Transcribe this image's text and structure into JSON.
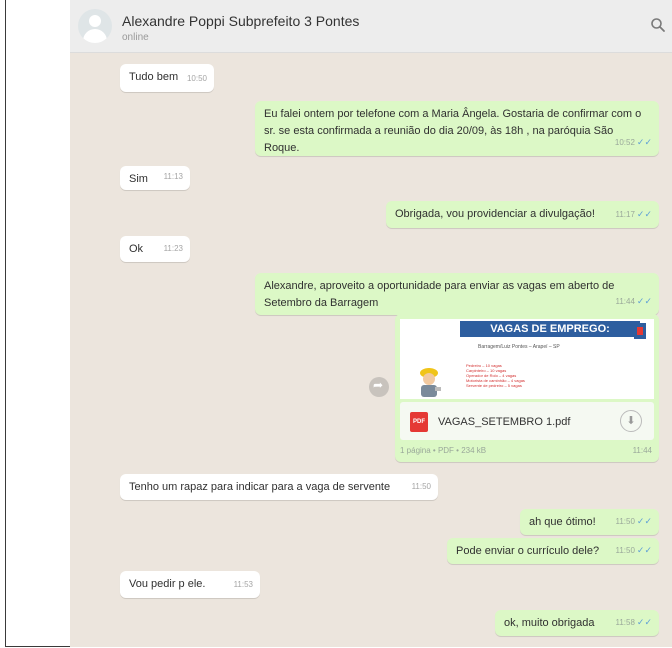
{
  "header": {
    "contact_name": "Alexandre Poppi Subprefeito 3 Pontes",
    "status": "online"
  },
  "messages": [
    {
      "id": "m1",
      "text": "Tudo bem",
      "time": "10:50"
    },
    {
      "id": "m2",
      "text": "Eu falei ontem por telefone com a Maria Ângela. Gostaria de confirmar com o sr. se esta confirmada a reunião do dia 20/09, às 18h , na paróquia São Roque.",
      "time": "10:52"
    },
    {
      "id": "m3",
      "text": "Sim",
      "time": "11:13"
    },
    {
      "id": "m4",
      "text": "Obrigada, vou providenciar a divulgação!",
      "time": "11:17"
    },
    {
      "id": "m5",
      "text": "Ok",
      "time": "11:23"
    },
    {
      "id": "m6",
      "text": "Alexandre, aproveito a oportunidade para enviar as vagas em aberto de Setembro da Barragem",
      "time": "11:44"
    },
    {
      "id": "m8",
      "text": "Tenho um rapaz para indicar para a vaga de servente",
      "time": "11:50"
    },
    {
      "id": "m9",
      "text": "ah que ótimo!",
      "time": "11:50"
    },
    {
      "id": "m10",
      "text": "Pode enviar o currículo dele?",
      "time": "11:50"
    },
    {
      "id": "m11",
      "text": "Vou pedir p ele.",
      "time": "11:53"
    },
    {
      "id": "m12",
      "text": "ok, muito obrigada",
      "time": "11:58"
    }
  ],
  "attachment": {
    "banner": "VAGAS DE EMPREGO:",
    "subtitle": "Barragem/Luiz Pontes – Arapeí – SP",
    "list": [
      "Pedreiro – 10 vagas",
      "Carpinteiro – 10 vagas",
      "Operador de Rolo – 4 vagas",
      "Motorista de caminhão – 4 vagas",
      "Servente de pedreiro – 5 vagas"
    ],
    "file_badge": "PDF",
    "file_name": "VAGAS_SETEMBRO 1.pdf",
    "file_meta": "1 página • PDF • 234 kB",
    "time": "11:44"
  },
  "icons": {
    "search": "search-icon",
    "download": "download-icon",
    "forward": "forward-icon",
    "read_receipt": "double-check-icon"
  },
  "colors": {
    "chat_bg": "#ece5dd",
    "incoming": "#ffffff",
    "outgoing": "#dcf8c6",
    "ticks": "#5e9fd6",
    "banner": "#2e5e9f"
  }
}
